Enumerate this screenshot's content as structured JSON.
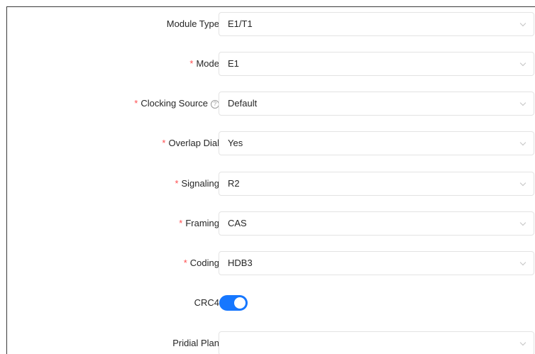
{
  "form": {
    "module_type": {
      "label": "Module Type",
      "required": false,
      "value": "E1/T1",
      "icon": "chevron-down-icon"
    },
    "mode": {
      "label": "Mode",
      "required": true,
      "required_mark": "*",
      "value": "E1",
      "icon": "chevron-down-icon"
    },
    "clocking_source": {
      "label": "Clocking Source",
      "required": true,
      "required_mark": "*",
      "help_glyph": "?",
      "help_icon": "question-circle-icon",
      "value": "Default",
      "icon": "chevron-down-icon"
    },
    "overlap_dial": {
      "label": "Overlap Dial",
      "required": true,
      "required_mark": "*",
      "value": "Yes",
      "icon": "chevron-down-icon"
    },
    "signaling": {
      "label": "Signaling",
      "required": true,
      "required_mark": "*",
      "value": "R2",
      "icon": "chevron-down-icon"
    },
    "framing": {
      "label": "Framing",
      "required": true,
      "required_mark": "*",
      "value": "CAS",
      "icon": "chevron-down-icon"
    },
    "coding": {
      "label": "Coding",
      "required": true,
      "required_mark": "*",
      "value": "HDB3",
      "icon": "chevron-down-icon"
    },
    "crc4": {
      "label": "CRC4",
      "enabled": true,
      "color": "#1677ff"
    },
    "pridial_plan": {
      "label": "Pridial Plan",
      "required": false,
      "value": "",
      "icon": "chevron-down-icon"
    }
  },
  "colors": {
    "required_mark": "#ff4d4f",
    "toggle_on": "#1677ff",
    "border": "#e3e3e3",
    "text": "#262626"
  }
}
